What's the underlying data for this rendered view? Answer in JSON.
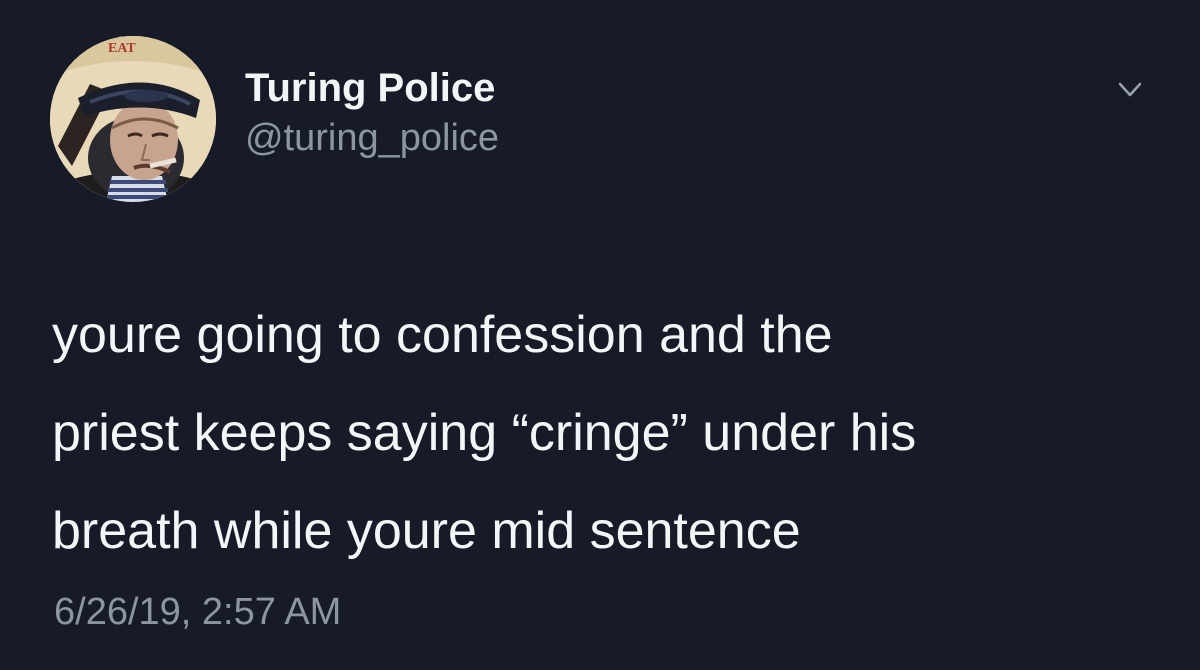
{
  "author": {
    "display_name": "Turing Police",
    "handle": "@turing_police",
    "avatar_lettering": "EAT"
  },
  "tweet": {
    "lines": [
      "youre going to confession and the",
      "priest keeps saying “cringe” under his",
      "breath while youre mid sentence"
    ],
    "timestamp": "6/26/19, 2:57 AM"
  },
  "icons": {
    "menu": "chevron-down-icon"
  },
  "colors": {
    "background": "#161b27",
    "primary_text": "#f4f5f7",
    "secondary_text": "#8c96a3",
    "chevron": "#9aa3ad"
  }
}
